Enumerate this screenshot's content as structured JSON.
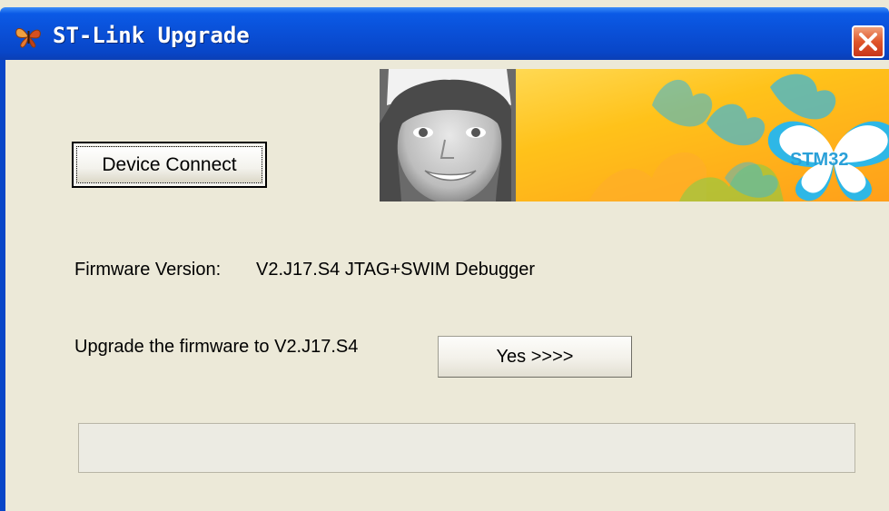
{
  "window": {
    "title": "ST-Link Upgrade"
  },
  "banner": {
    "brand_text": "STM32"
  },
  "actions": {
    "connect_label": "Device Connect",
    "yes_label": "Yes >>>>"
  },
  "firmware": {
    "label": "Firmware Version:",
    "value": "V2.J17.S4 JTAG+SWIM Debugger"
  },
  "upgrade": {
    "label": "Upgrade the firmware to V2.J17.S4"
  },
  "progress": {
    "value_fraction": 0
  },
  "colors": {
    "titlebar_blue": "#0a4fd6",
    "dialog_bg": "#ece9d8",
    "close_red": "#e0562b",
    "banner_yellow": "#ffc21a",
    "banner_cyan": "#2eb7e6"
  },
  "icons": {
    "app": "butterfly-icon",
    "close": "close-icon"
  }
}
